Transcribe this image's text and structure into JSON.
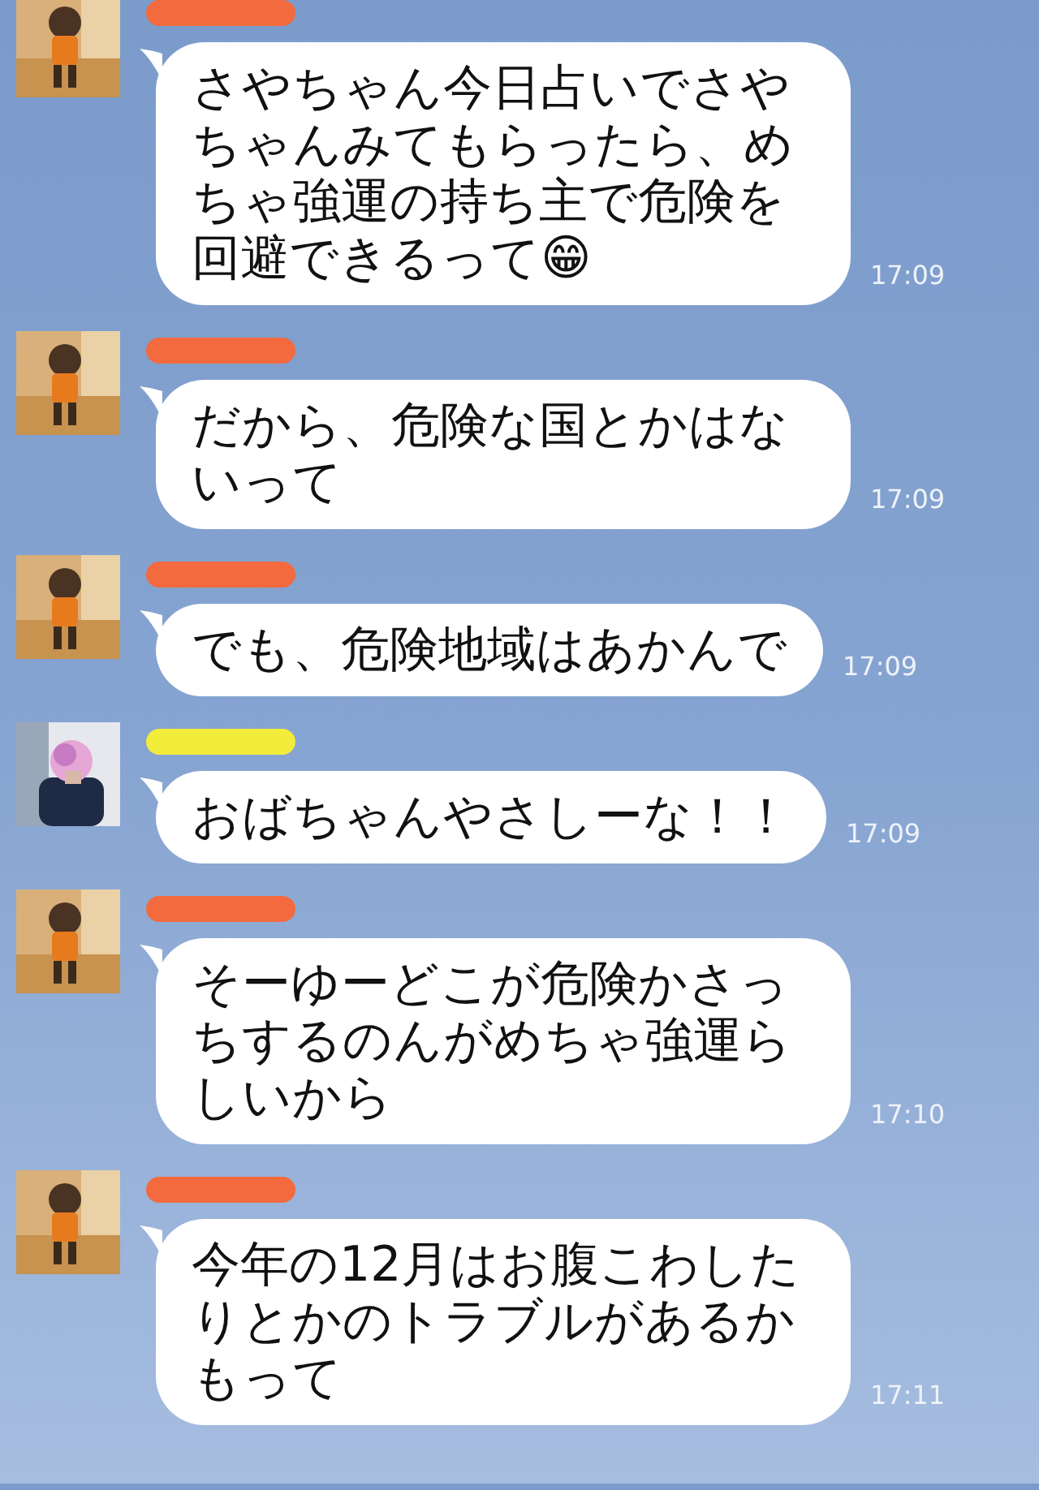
{
  "messages": [
    {
      "color": "#f26a3d",
      "text": "さやちゃん今日占いでさやちゃんみてもらったら、めちゃ強運の持ち主で危険を回避できるって😁",
      "time": "17:09"
    },
    {
      "color": "#f26a3d",
      "text": "だから、危険な国とかはないって",
      "time": "17:09"
    },
    {
      "color": "#f26a3d",
      "text": "でも、危険地域はあかんで",
      "time": "17:09"
    },
    {
      "color": "#f2ec3a",
      "text": "おばちゃんやさしーな！！",
      "time": "17:09"
    },
    {
      "color": "#f26a3d",
      "text": "そーゆーどこが危険かさっちするのんがめちゃ強運らしいから",
      "time": "17:10"
    },
    {
      "color": "#f26a3d",
      "text": "今年の12月はお腹こわしたりとかのトラブルがあるかもって",
      "time": "17:11"
    }
  ]
}
